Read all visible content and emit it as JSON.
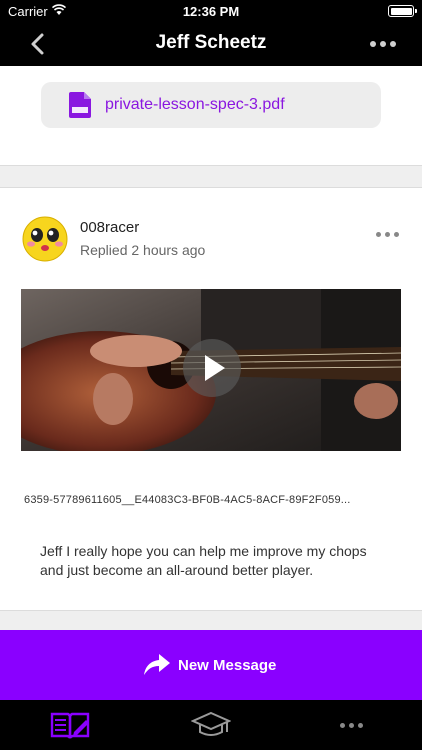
{
  "status_bar": {
    "carrier": "Carrier",
    "time": "12:36 PM"
  },
  "nav": {
    "title": "Jeff Scheetz",
    "back_icon": "chevron-left-icon",
    "more_icon": "ellipsis-icon"
  },
  "attachment": {
    "file_name": "private-lesson-spec-3.pdf",
    "icon": "pdf-file-icon",
    "color": "#8a17e0"
  },
  "post": {
    "author": "008racer",
    "replied": "Replied 2 hours ago",
    "video_caption": "6359-57789611605__E44083C3-BF0B-4AC5-8ACF-89F2F059...",
    "message": "Jeff I really hope you can help me improve my chops and just become an all-around better player."
  },
  "action": {
    "label": "New Message",
    "icon": "share-arrow-icon",
    "color": "#8a00ff"
  },
  "tab_bar": {
    "tabs": [
      {
        "name": "lessons",
        "icon": "book-pencil-icon",
        "active": true,
        "color": "#8a00ff"
      },
      {
        "name": "courses",
        "icon": "graduation-cap-icon",
        "active": false
      },
      {
        "name": "more",
        "icon": "ellipsis-icon",
        "active": false
      }
    ]
  }
}
